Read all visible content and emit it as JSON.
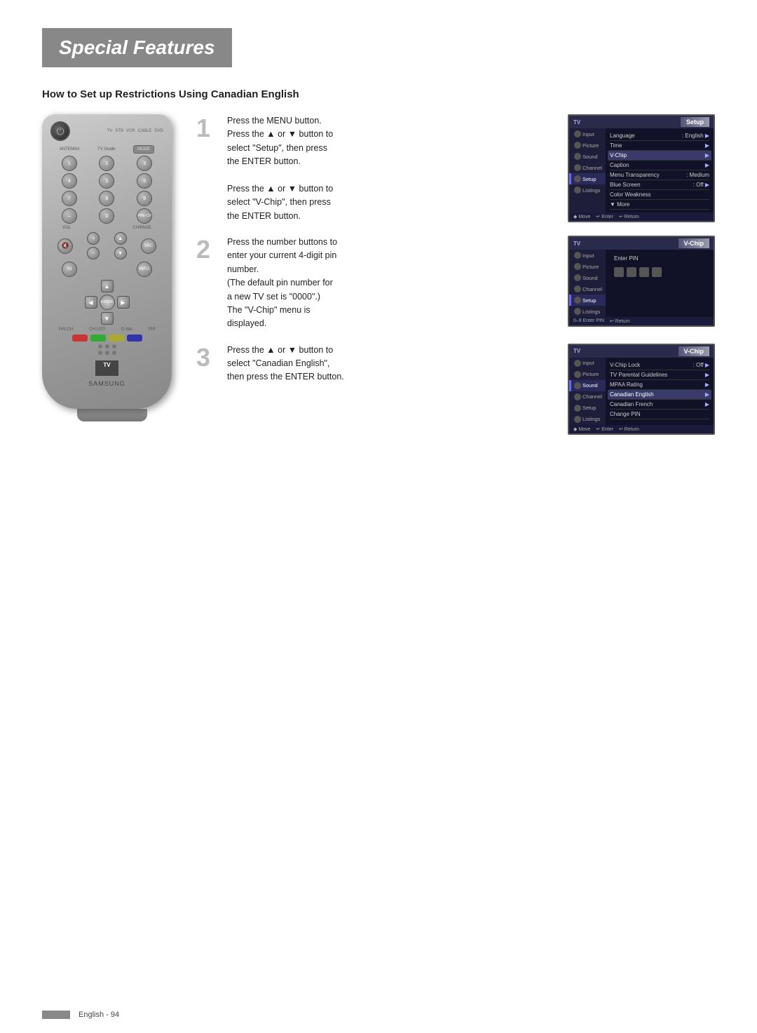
{
  "page": {
    "title": "Special Features",
    "footer_text": "English - 94"
  },
  "section": {
    "heading": "How to Set up Restrictions Using Canadian English"
  },
  "steps": [
    {
      "number": "1",
      "text_lines": [
        "Press the MENU button.",
        "Press the ▲ or ▼ button to",
        "select \"Setup\", then press",
        "the ENTER button.",
        "",
        "Press the ▲ or ▼ button to",
        "select \"V-Chip\", then press",
        "the ENTER button."
      ]
    },
    {
      "number": "2",
      "text_lines": [
        "Press the number buttons to",
        "enter your current 4-digit pin",
        "number.",
        "(The default pin number for",
        "a new TV set is \"0000\".)",
        "The \"V-Chip\" menu is",
        "displayed."
      ]
    },
    {
      "number": "3",
      "text_lines": [
        "Press the ▲ or ▼ button to",
        "select \"Canadian English\",",
        "then press the ENTER button."
      ]
    }
  ],
  "remote": {
    "brand": "SAMSUNG",
    "tv_label": "TV",
    "guide_label": "GUIDE"
  },
  "tv_screens": [
    {
      "id": "setup",
      "header_tv": "TV",
      "header_title": "Setup",
      "left_menu": [
        "Input",
        "Picture",
        "Sound",
        "Channel",
        "Setup",
        "Listings"
      ],
      "active_menu": "Setup",
      "menu_rows": [
        {
          "label": "Language",
          "value": ": English",
          "arrow": true
        },
        {
          "label": "Time",
          "value": "",
          "arrow": true
        },
        {
          "label": "V-Chip",
          "value": "",
          "arrow": true
        },
        {
          "label": "Caption",
          "value": "",
          "arrow": true
        },
        {
          "label": "Menu Transparency",
          "value": ": Medium",
          "arrow": false
        },
        {
          "label": "Blue Screen",
          "value": ": Off",
          "arrow": true
        },
        {
          "label": "Color Weakness",
          "value": "",
          "arrow": false
        },
        {
          "label": "▼ More",
          "value": "",
          "arrow": false
        }
      ],
      "footer": [
        "◆ Move",
        "↵ Enter",
        "↩ Return"
      ]
    },
    {
      "id": "vchip-pin",
      "header_tv": "TV",
      "header_title": "V-Chip",
      "left_menu": [
        "Input",
        "Picture",
        "Sound",
        "Channel",
        "Setup",
        "Listings"
      ],
      "active_menu": "Setup",
      "enter_pin_label": "Enter PIN",
      "pin_dots": 4,
      "footer": [
        "0–9 Enter PIN",
        "↩ Return"
      ]
    },
    {
      "id": "vchip-english",
      "header_tv": "TV",
      "header_title": "V-Chip",
      "left_menu": [
        "Input",
        "Picture",
        "Sound",
        "Channel",
        "Setup",
        "Listings"
      ],
      "active_menu": "Sound",
      "menu_rows": [
        {
          "label": "V-Chip Lock",
          "value": ": Off",
          "arrow": true
        },
        {
          "label": "TV Parental Guidelines",
          "value": "",
          "arrow": true
        },
        {
          "label": "MPAA Rating",
          "value": "",
          "arrow": true
        },
        {
          "label": "Canadian English",
          "value": "",
          "arrow": true,
          "highlighted": true
        },
        {
          "label": "Canadian French",
          "value": "",
          "arrow": true
        },
        {
          "label": "Change PIN",
          "value": "",
          "arrow": false
        }
      ],
      "footer": [
        "◆ Move",
        "↵ Enter",
        "↩ Return"
      ]
    }
  ]
}
